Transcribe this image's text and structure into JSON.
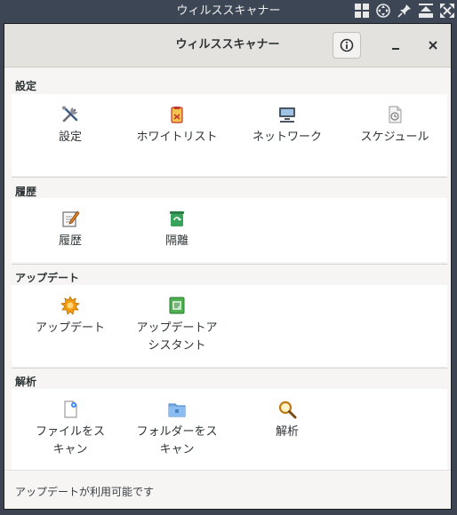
{
  "os": {
    "window_title": "ウィルススキャナー"
  },
  "header": {
    "title": "ウィルススキャナー"
  },
  "sections": {
    "settings": {
      "title": "設定",
      "items": {
        "settings": "設定",
        "whitelist": "ホワイトリスト",
        "network": "ネットワーク",
        "schedule": "スケジュール"
      }
    },
    "history": {
      "title": "履歴",
      "items": {
        "history": "履歴",
        "quarantine": "隔離"
      }
    },
    "update": {
      "title": "アップデート",
      "items": {
        "update": "アップデート",
        "assistant": "アップデートア\nシスタント"
      }
    },
    "analysis": {
      "title": "解析",
      "items": {
        "scan_file": "ファイルをス\nキャン",
        "scan_folder": "フォルダーをス\nキャン",
        "analyze": "解析"
      }
    }
  },
  "status": {
    "text": "アップデートが利用可能です"
  },
  "icons": {
    "info": "info-icon",
    "minimize": "minimize-icon",
    "close": "close-icon"
  },
  "colors": {
    "titlebar": "#3c4654",
    "headerbar": "#e4e2df",
    "content": "#ffffff",
    "background": "#f6f5f4"
  }
}
